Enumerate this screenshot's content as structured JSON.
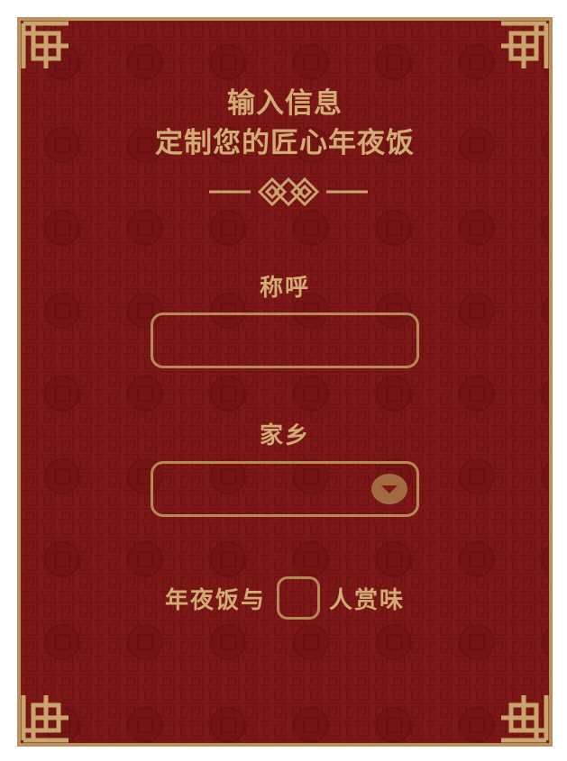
{
  "form": {
    "title_line1": "输入信息",
    "title_line2": "定制您的匠心年夜饭",
    "name": {
      "label": "称呼",
      "value": "",
      "placeholder": ""
    },
    "hometown": {
      "label": "家乡",
      "selected_value": "",
      "dropdown_icon": "chevron-down-icon"
    },
    "party": {
      "prefix": "年夜饭与",
      "count_value": "",
      "suffix": "人赏味"
    }
  },
  "theme": {
    "background": "#7e1717",
    "gold": "#d2ad73",
    "border_gold": "#b7925c",
    "accent_brown": "#a36a42"
  }
}
